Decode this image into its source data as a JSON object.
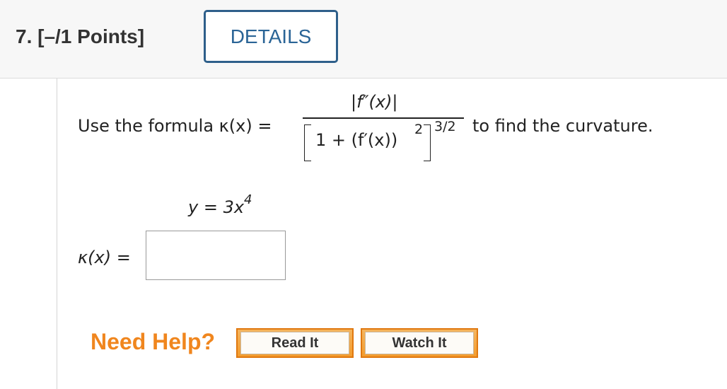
{
  "header": {
    "question_label": "7. [–/1 Points]",
    "details_button": "DETAILS"
  },
  "problem": {
    "prompt_before": "Use the formula κ(x) =",
    "numerator": "|f″(x)|",
    "denominator": "1 + (f′(x))",
    "denominator_square": "2",
    "outer_exponent": "3/2",
    "prompt_after": "to find the curvature.",
    "equation_lhs": "y = 3x",
    "equation_exponent": "4",
    "answer_label": "κ(x) =",
    "answer_value": ""
  },
  "help": {
    "need_help_label": "Need Help?",
    "read_it_label": "Read It",
    "watch_it_label": "Watch It"
  },
  "colors": {
    "details_border": "#2e5f8a",
    "need_help": "#f0861e",
    "help_button_border": "#e0780f"
  }
}
